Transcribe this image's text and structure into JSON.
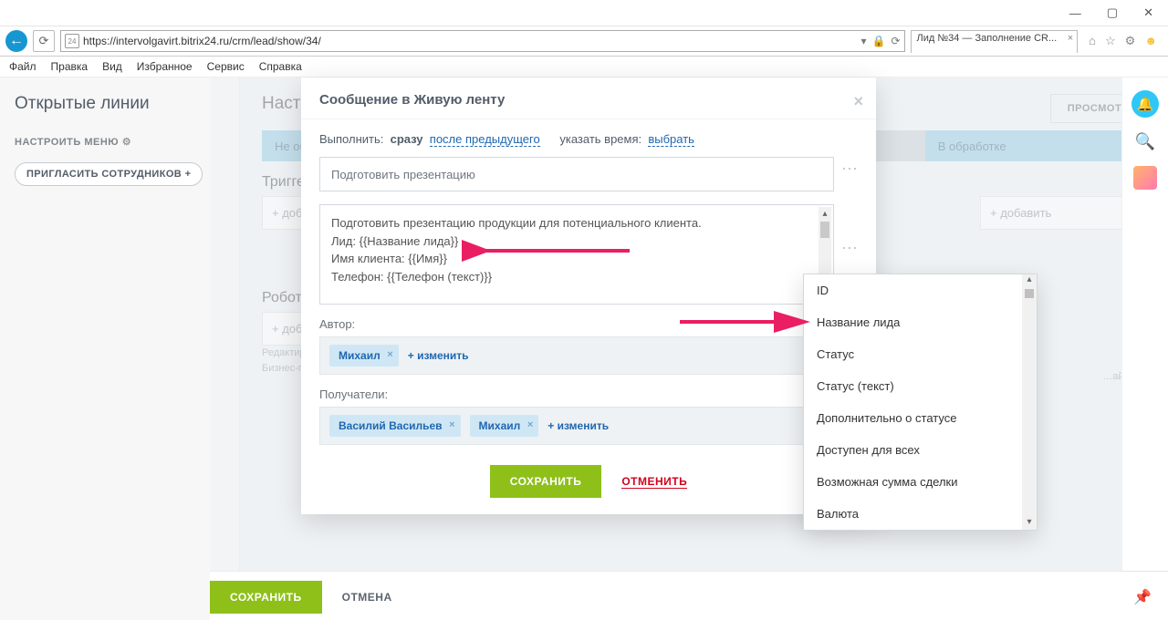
{
  "window": {
    "min": "—",
    "max": "▢",
    "close": "✕"
  },
  "browser": {
    "url": "https://intervolgavirt.bitrix24.ru/crm/lead/show/34/",
    "tab_title": "Лид №34 — Заполнение CR...",
    "favicon": "24",
    "menu": [
      "Файл",
      "Правка",
      "Вид",
      "Избранное",
      "Сервис",
      "Справка"
    ]
  },
  "sidebar": {
    "title": "Открытые линии",
    "menu_cfg": "НАСТРОИТЬ МЕНЮ",
    "invite": "ПРИГЛАСИТЬ СОТРУДНИКОВ  +"
  },
  "page": {
    "title": "Настройка роботов для всех лидов",
    "preview": "ПРОСМОТР",
    "stages": {
      "s1": "Не обработан",
      "s2": "В обработке"
    },
    "triggers": "Триггеры",
    "robots": "Роботы",
    "add": "+ добавить",
    "hint1": "Редактирование шаблонов",
    "hint2": "Бизнес-процессов",
    "hint_right": "…айнеро"
  },
  "footer": {
    "save": "СОХРАНИТЬ",
    "cancel": "ОТМЕНА"
  },
  "modal": {
    "title": "Сообщение в Живую ленту",
    "exec_label": "Выполнить:",
    "exec_now": "сразу",
    "exec_after": "после предыдущего",
    "time_label": "указать время:",
    "time_pick": "выбрать",
    "subject": "Подготовить презентацию",
    "body_l1": "Подготовить презентацию продукции для потенциального клиента.",
    "body_l2": "Лид: {{Название лида}}",
    "body_l3": "Имя клиента: {{Имя}}",
    "body_l4": "Телефон: {{Телефон (текст)}}",
    "author_label": "Автор:",
    "author_chip": "Михаил",
    "recipients_label": "Получатели:",
    "recipient1": "Василий Васильев",
    "recipient2": "Михаил",
    "change": "+ изменить",
    "save": "СОХРАНИТЬ",
    "cancel": "ОТМЕНИТЬ"
  },
  "dropdown": {
    "items": [
      "ID",
      "Название лида",
      "Статус",
      "Статус (текст)",
      "Дополнительно о статусе",
      "Доступен для всех",
      "Возможная сумма сделки",
      "Валюта"
    ]
  }
}
